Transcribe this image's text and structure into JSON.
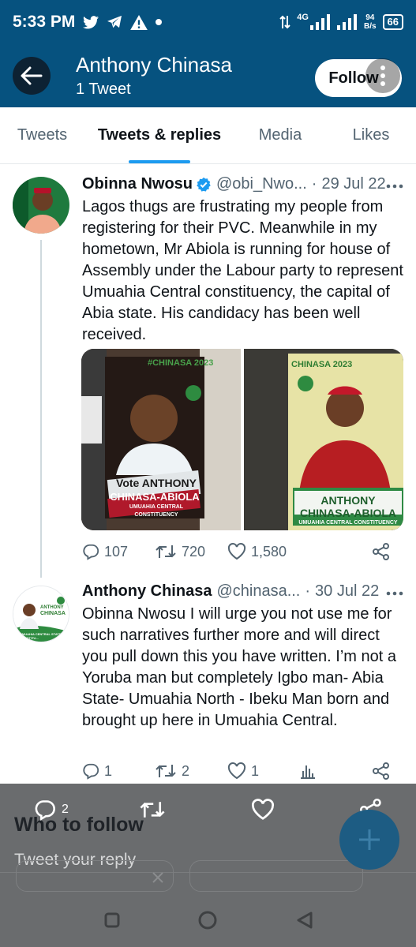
{
  "status_bar": {
    "time": "5:33 PM",
    "net_speed_value": "94",
    "net_speed_unit": "B/s",
    "network_type": "4G",
    "battery": "66",
    "icons": [
      "twitter-icon",
      "telegram-icon",
      "alert-icon",
      "dot-icon",
      "data-arrows-icon",
      "signal-icon",
      "wifi-signal-icon",
      "battery-icon"
    ]
  },
  "header": {
    "name": "Anthony Chinasa",
    "tweet_count": "1 Tweet",
    "follow_label": "Follow",
    "colors": {
      "background": "#06527f"
    }
  },
  "tabs": [
    {
      "label": "Tweets",
      "active": false
    },
    {
      "label": "Tweets & replies",
      "active": true
    },
    {
      "label": "Media",
      "active": false
    },
    {
      "label": "Likes",
      "active": false
    }
  ],
  "tweets": [
    {
      "display_name": "Obinna Nwosu",
      "handle": "@obi_Nwo...",
      "date": "29 Jul 22",
      "verified": true,
      "text": "Lagos thugs are frustrating my people from registering for their PVC. Meanwhile in my hometown, Mr Abiola is running for house of Assembly under the Labour party to represent Umuahia Central constituency, the capital of Abia state. His candidacy has been well received.",
      "media": [
        {
          "tag": "#CHINASA 2023",
          "caption_line1": "Vote ANTHONY",
          "caption_line2": "CHINASA-ABIOLA",
          "caption_line3": "UMUAHIA CENTRAL CONSTITUENCY"
        },
        {
          "tag": "CHINASA 2023",
          "caption_line1": "ANTHONY",
          "caption_line2": "CHINASA-ABIOLA",
          "caption_line3": "UMUAHIA CENTRAL CONSTITUENCY"
        }
      ],
      "replies": "107",
      "retweets": "720",
      "likes": "1,580"
    },
    {
      "display_name": "Anthony Chinasa",
      "handle": "@chinasa...",
      "date": "30 Jul 22",
      "verified": false,
      "text": "Obinna Nwosu I will urge you not use me for such narratives further more and will direct you pull down this you have written. I’m not a Yoruba man but completely Igbo man- Abia State- Umuahia North - Ibeku Man born and brought up here in Umuahia Central.",
      "avatar_text": {
        "line1": "ANTHONY",
        "line2": "CHINASA",
        "line3": "UMUAHIA CENTRAL STATE CONSTITU..."
      },
      "replies": "1",
      "retweets": "2",
      "likes": "1"
    }
  ],
  "overlay": {
    "who_to_follow": "Who to follow",
    "reply_placeholder": "Tweet your reply",
    "reply_count": "2"
  },
  "colors": {
    "accent": "#1d9bf0",
    "secondary_text": "#536471"
  }
}
